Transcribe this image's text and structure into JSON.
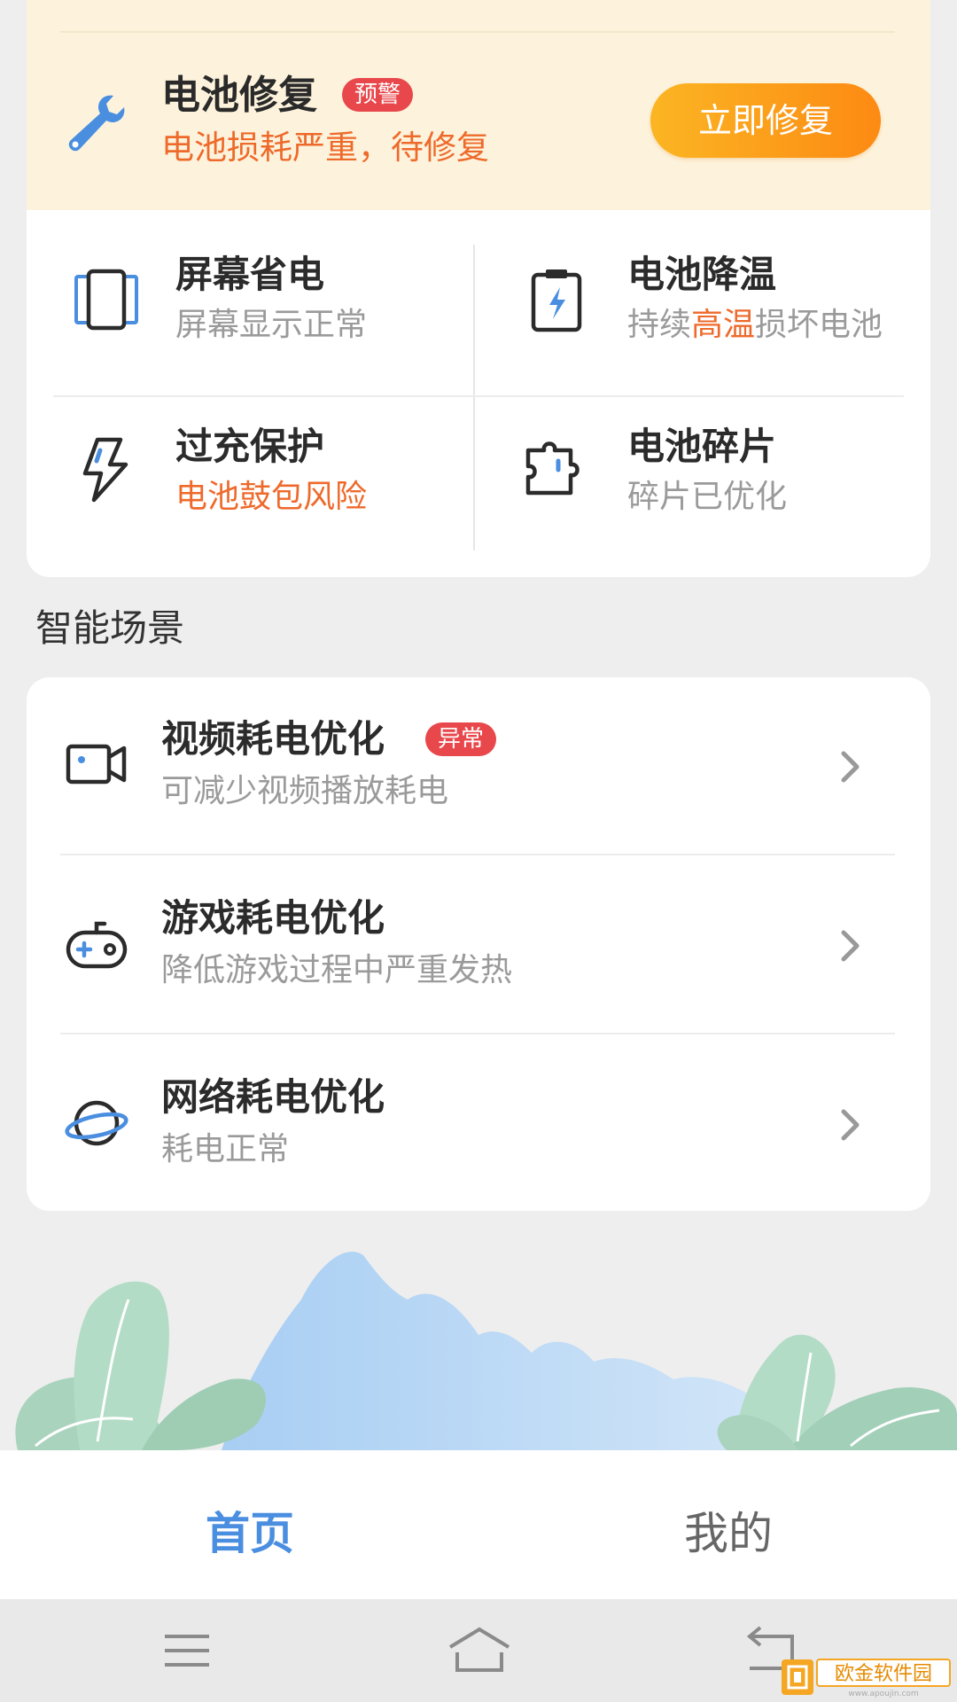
{
  "warning": {
    "title": "电池修复",
    "badge": "预警",
    "subtitle": "电池损耗严重，待修复",
    "button": "立即修复",
    "icon": "wrench-icon"
  },
  "features": [
    {
      "title": "屏幕省电",
      "sub": "屏幕显示正常",
      "icon": "screen-icon"
    },
    {
      "title": "电池降温",
      "sub_parts": [
        "持续",
        "高温",
        "损坏电池"
      ],
      "icon": "battery-cool-icon"
    },
    {
      "title": "过充保护",
      "sub": "电池鼓包风险",
      "icon": "lightning-icon"
    },
    {
      "title": "电池碎片",
      "sub": "碎片已优化",
      "icon": "puzzle-icon"
    }
  ],
  "section_title": "智能场景",
  "scenes": [
    {
      "title": "视频耗电优化",
      "badge": "异常",
      "sub": "可减少视频播放耗电",
      "icon": "video-camera-icon"
    },
    {
      "title": "游戏耗电优化",
      "sub": "降低游戏过程中严重发热",
      "icon": "gamepad-icon"
    },
    {
      "title": "网络耗电优化",
      "sub": "耗电正常",
      "icon": "planet-icon"
    }
  ],
  "tabs": {
    "home": "首页",
    "mine": "我的"
  },
  "watermark": {
    "text": "欧金软件园",
    "url": "www.apoujin.com"
  },
  "colors": {
    "accent_blue": "#4a8ee0",
    "warning_orange": "#ee6a2b",
    "badge_red": "#e8484c",
    "button_gradient_start": "#fbb523",
    "button_gradient_end": "#fd8a13",
    "warning_bg": "#fdf3dc"
  }
}
